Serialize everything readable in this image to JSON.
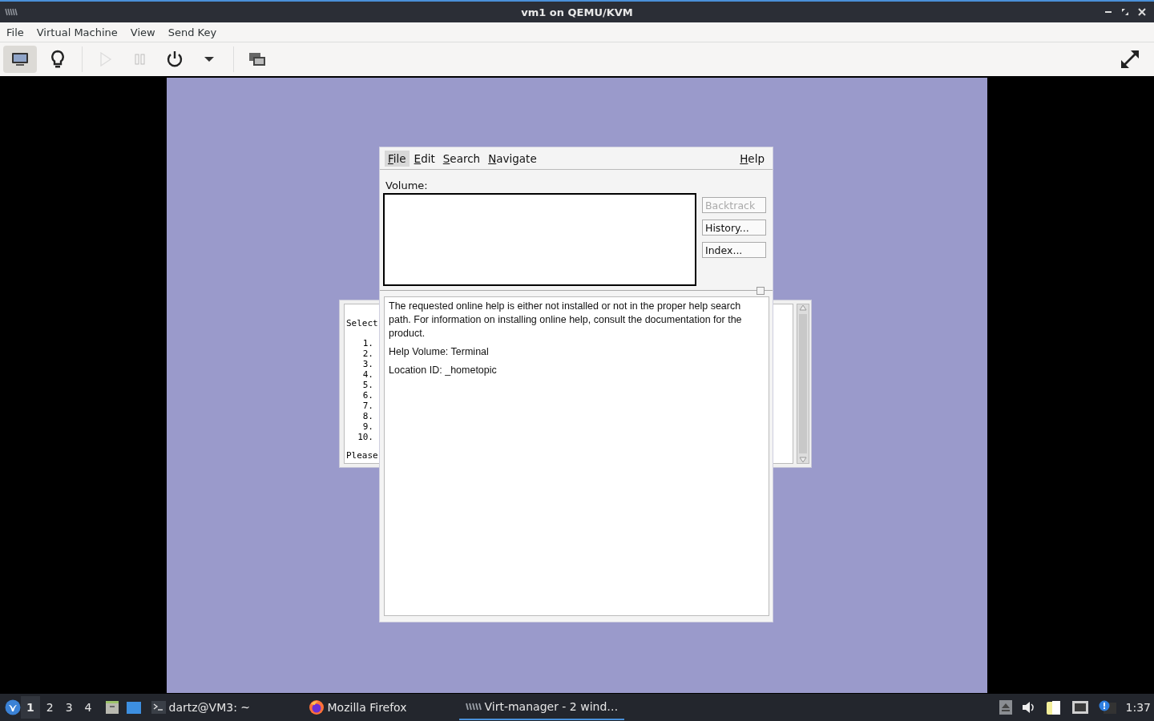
{
  "window": {
    "title": "vm1 on QEMU/KVM"
  },
  "menubar": [
    "File",
    "Virtual Machine",
    "View",
    "Send Key"
  ],
  "toolbar": [
    {
      "kind": "console",
      "selected": true,
      "disabled": false
    },
    {
      "kind": "details",
      "selected": false,
      "disabled": false
    },
    {
      "kind": "run",
      "selected": false,
      "disabled": true
    },
    {
      "kind": "pause",
      "selected": false,
      "disabled": true
    },
    {
      "kind": "shutdown",
      "selected": false,
      "disabled": false
    },
    {
      "kind": "dropdown",
      "selected": false,
      "disabled": false
    },
    {
      "kind": "snapshots",
      "selected": false,
      "disabled": false
    },
    {
      "kind": "fullscreen",
      "selected": false,
      "disabled": false
    }
  ],
  "guest": {
    "back_window": {
      "heading": "Select",
      "items": [
        "1.",
        "2.",
        "3.",
        "4.",
        "5.",
        "6.",
        "7.",
        "8.",
        "9.",
        "10."
      ],
      "footer": "Please"
    },
    "help_window": {
      "menus": [
        {
          "label": "File",
          "selected": true
        },
        {
          "label": "Edit",
          "selected": false
        },
        {
          "label": "Search",
          "selected": false
        },
        {
          "label": "Navigate",
          "selected": false
        },
        {
          "label": "Help",
          "selected": false
        }
      ],
      "volume_label": "Volume:",
      "buttons": [
        {
          "label": "Backtrack",
          "disabled": true
        },
        {
          "label": "History...",
          "disabled": false
        },
        {
          "label": "Index...",
          "disabled": false
        }
      ],
      "paragraphs": [
        "The requested online help is either not installed or not in the proper help search path.  For information on installing online help, consult the documentation for the product.",
        "Help Volume: Terminal",
        "Location ID: _hometopic"
      ]
    }
  },
  "taskbar": {
    "workspaces": [
      {
        "label": "1",
        "selected": true
      },
      {
        "label": "2",
        "selected": false
      },
      {
        "label": "3",
        "selected": false
      },
      {
        "label": "4",
        "selected": false
      }
    ],
    "tasks": [
      {
        "kind": "terminal",
        "label": "dartz@VM3: ~",
        "selected": false
      },
      {
        "kind": "browser",
        "label": "Mozilla Firefox",
        "selected": false
      },
      {
        "kind": "virt",
        "label": "Virt-manager - 2 wind…",
        "selected": true
      }
    ],
    "clock": "1:37"
  }
}
